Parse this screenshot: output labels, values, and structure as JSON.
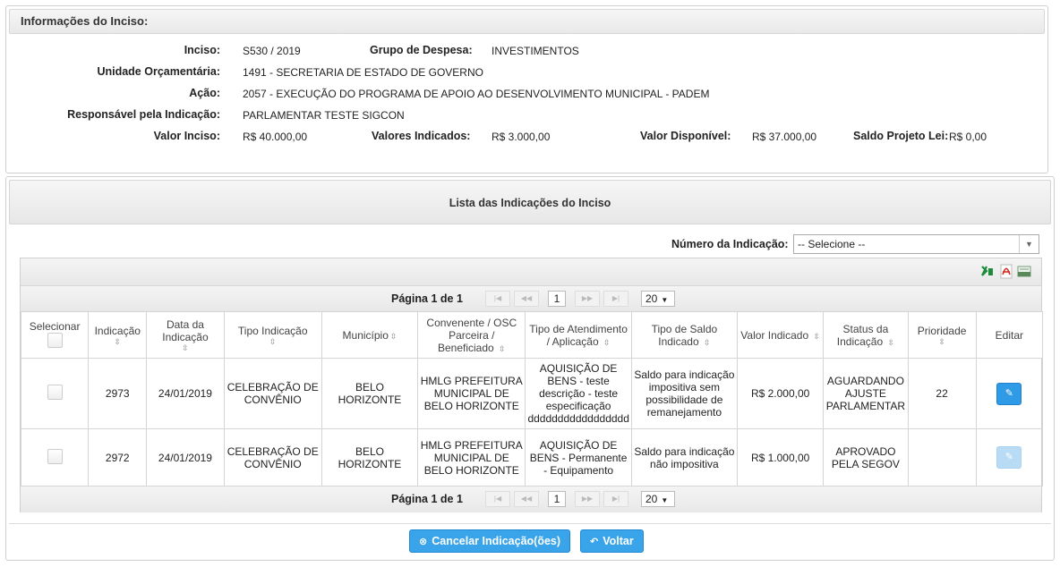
{
  "info": {
    "title": "Informações do Inciso:",
    "fields": {
      "inciso_label": "Inciso:",
      "inciso_value": "S530 / 2019",
      "grupo_label": "Grupo de Despesa:",
      "grupo_value": "INVESTIMENTOS",
      "unidade_label": "Unidade Orçamentária:",
      "unidade_value": "1491 - SECRETARIA DE ESTADO DE GOVERNO",
      "acao_label": "Ação:",
      "acao_value": "2057 - EXECUÇÃO DO PROGRAMA DE APOIO AO DESENVOLVIMENTO MUNICIPAL - PADEM",
      "resp_label": "Responsável pela Indicação:",
      "resp_value": "PARLAMENTAR TESTE SIGCON",
      "valor_inciso_label": "Valor Inciso:",
      "valor_inciso_value": "R$ 40.000,00",
      "valores_ind_label": "Valores Indicados:",
      "valores_ind_value": "R$ 3.000,00",
      "valor_disp_label": "Valor Disponível:",
      "valor_disp_value": "R$ 37.000,00",
      "saldo_label": "Saldo Projeto Lei:",
      "saldo_value": "R$ 0,00"
    }
  },
  "list": {
    "title": "Lista das Indicações do Inciso",
    "filter_label": "Número da Indicação:",
    "filter_value": "-- Selecione --",
    "pager": {
      "text": "Página 1 de 1",
      "current": "1",
      "page_size": "20"
    },
    "columns": {
      "selecionar": "Selecionar",
      "indicacao": "Indicação",
      "data": "Data da Indicação",
      "tipo": "Tipo Indicação",
      "municipio": "Município",
      "convenente": "Convenente / OSC Parceira / Beneficiado",
      "atendimento": "Tipo de Atendimento / Aplicação",
      "saldo": "Tipo de Saldo Indicado",
      "valor": "Valor Indicado",
      "status": "Status da Indicação",
      "prioridade": "Prioridade",
      "editar": "Editar"
    },
    "rows": [
      {
        "indicacao": "2973",
        "data": "24/01/2019",
        "tipo": "CELEBRAÇÃO DE CONVÊNIO",
        "municipio": "BELO HORIZONTE",
        "convenente": "HMLG PREFEITURA MUNICIPAL DE BELO HORIZONTE",
        "atendimento_1": "AQUISIÇÃO DE BENS - teste descrição - teste especificação",
        "atendimento_2": "ddddddddddddddddddd",
        "saldo": "Saldo para indicação impositiva sem possibilidade de remanejamento",
        "valor": "R$ 2.000,00",
        "status": "AGUARDANDO AJUSTE PARLAMENTAR",
        "prioridade": "22"
      },
      {
        "indicacao": "2972",
        "data": "24/01/2019",
        "tipo": "CELEBRAÇÃO DE CONVÊNIO",
        "municipio": "BELO HORIZONTE",
        "convenente": "HMLG PREFEITURA MUNICIPAL DE BELO HORIZONTE",
        "atendimento_1": "AQUISIÇÃO DE BENS - Permanente - Equipamento",
        "atendimento_2": "",
        "saldo": "Saldo para indicação não impositiva",
        "valor": "R$ 1.000,00",
        "status": "APROVADO PELA SEGOV",
        "prioridade": ""
      }
    ]
  },
  "actions": {
    "cancel_label": "Cancelar Indicação(ões)",
    "back_label": "Voltar"
  },
  "icons": [
    "excel-export-icon",
    "pdf-export-icon",
    "csv-export-icon",
    "sort-icon",
    "edit-pencil-icon",
    "cancel-circle-icon",
    "back-arrow-icon"
  ],
  "colors": {
    "primary": "#39a4ea",
    "edit": "#2f9ae6",
    "pdf": "#d9261c",
    "excel": "#1c8b3c"
  }
}
